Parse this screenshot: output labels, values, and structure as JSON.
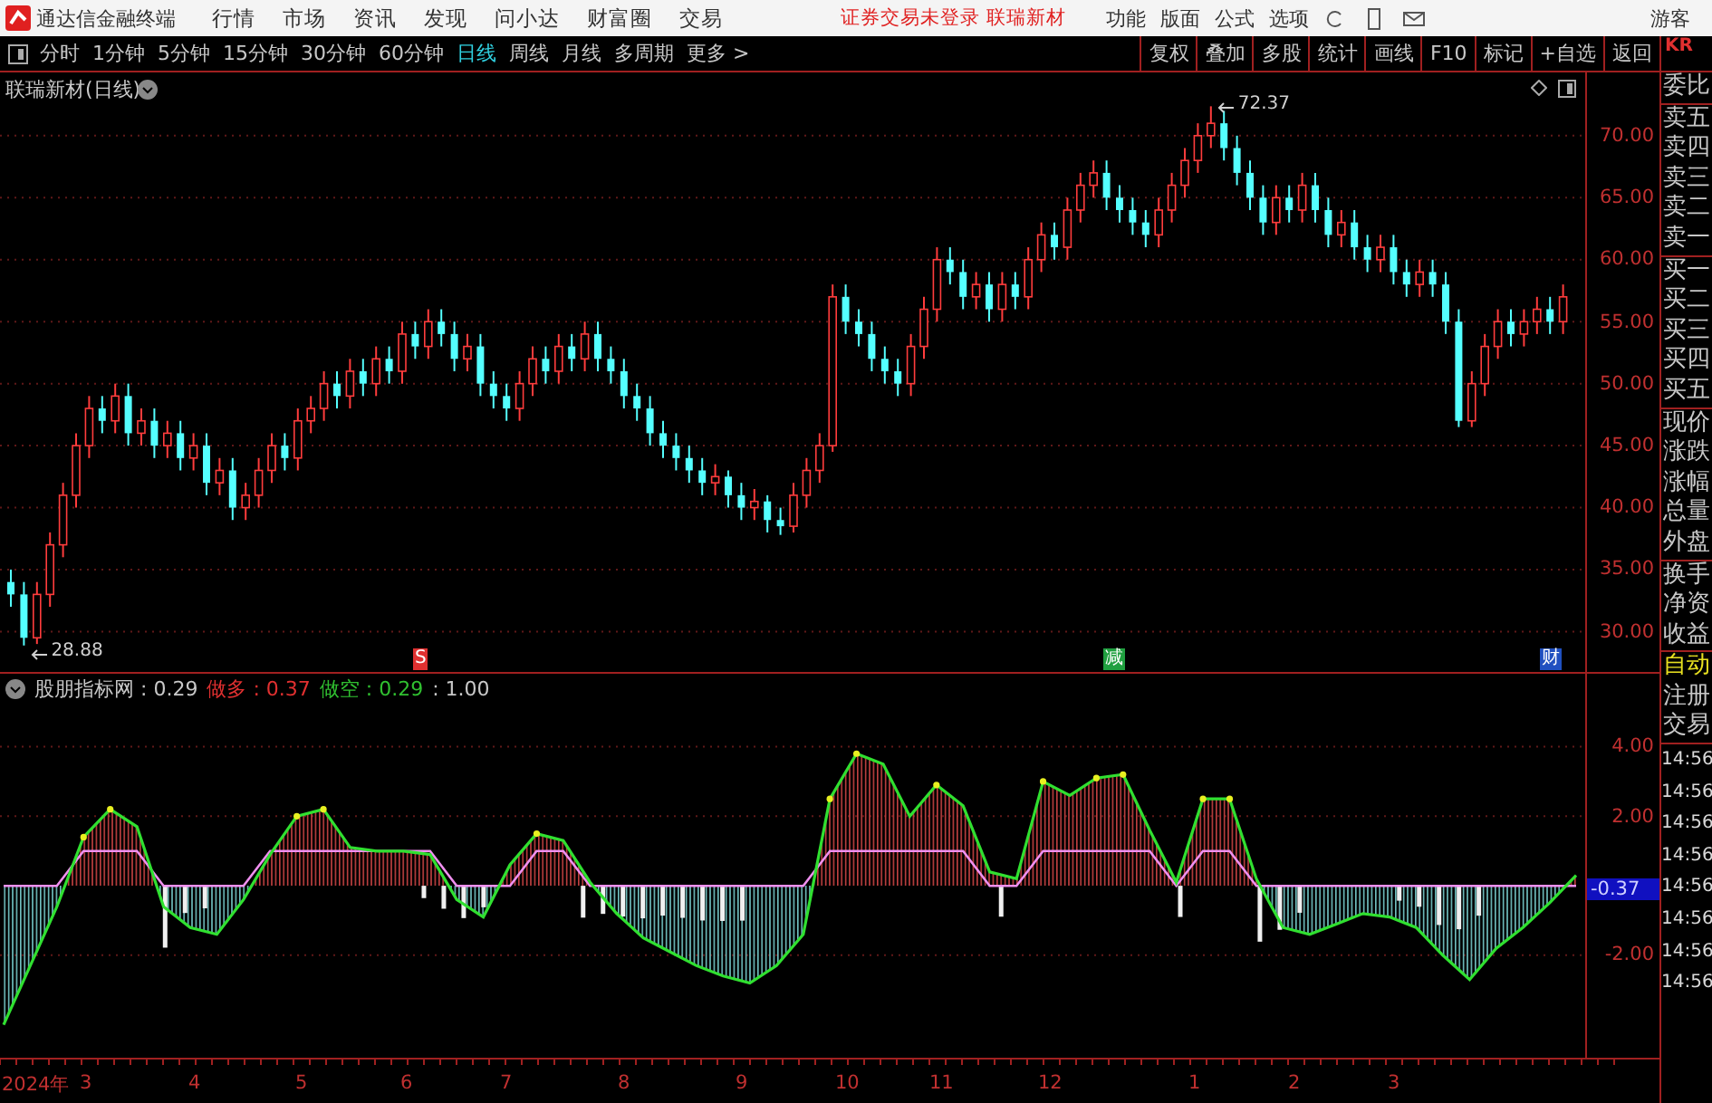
{
  "title_bar": {
    "app_name": "通达信金融终端",
    "menus": [
      "行情",
      "市场",
      "资讯",
      "发现",
      "问小达",
      "财富圈",
      "交易"
    ],
    "notice": "证券交易未登录  联瑞新材",
    "tools": [
      "功能",
      "版面",
      "公式",
      "选项"
    ],
    "user": "游客"
  },
  "toolbar": {
    "periods": [
      {
        "label": "分时",
        "selected": false
      },
      {
        "label": "1分钟",
        "selected": false
      },
      {
        "label": "5分钟",
        "selected": false
      },
      {
        "label": "15分钟",
        "selected": false
      },
      {
        "label": "30分钟",
        "selected": false
      },
      {
        "label": "60分钟",
        "selected": false
      },
      {
        "label": "日线",
        "selected": true
      },
      {
        "label": "周线",
        "selected": false
      },
      {
        "label": "月线",
        "selected": false
      },
      {
        "label": "多周期",
        "selected": false
      },
      {
        "label": "更多 >",
        "selected": false
      }
    ],
    "actions": [
      "复权",
      "叠加",
      "多股",
      "统计",
      "画线",
      "F10",
      "标记",
      "+自选",
      "返回"
    ]
  },
  "main_chart": {
    "title": "联瑞新材(日线)",
    "high_label": "72.37",
    "low_label": "28.88",
    "markers": [
      {
        "text": "S",
        "color": "#e03030"
      },
      {
        "text": "减",
        "color": "#20a040"
      },
      {
        "text": "财",
        "color": "#2050c0"
      }
    ],
    "chart_data": {
      "type": "candlestick",
      "grid": true,
      "ylim": [
        26.6,
        75.1
      ],
      "yticks": [
        {
          "value": 70,
          "label": "70.00"
        },
        {
          "value": 65,
          "label": "65.00"
        },
        {
          "value": 60,
          "label": "60.00"
        },
        {
          "value": 55,
          "label": "55.00"
        },
        {
          "value": 50,
          "label": "50.00"
        },
        {
          "value": 45,
          "label": "45.00"
        },
        {
          "value": 40,
          "label": "40.00"
        },
        {
          "value": 35,
          "label": "35.00"
        },
        {
          "value": 30,
          "label": "30.00"
        }
      ],
      "ohlc": [
        [
          34,
          35,
          32,
          33
        ],
        [
          33,
          34,
          28.88,
          29.5
        ],
        [
          29.5,
          34,
          29,
          33
        ],
        [
          33,
          38,
          32,
          37
        ],
        [
          37,
          42,
          36,
          41
        ],
        [
          41,
          46,
          40,
          45
        ],
        [
          45,
          49,
          44,
          48
        ],
        [
          48,
          49,
          46,
          47
        ],
        [
          47,
          50,
          46,
          49
        ],
        [
          49,
          50,
          45,
          46
        ],
        [
          46,
          48,
          45,
          47
        ],
        [
          47,
          48,
          44,
          45
        ],
        [
          45,
          47,
          44,
          46
        ],
        [
          46,
          47,
          43,
          44
        ],
        [
          44,
          46,
          43,
          45
        ],
        [
          45,
          46,
          41,
          42
        ],
        [
          42,
          44,
          41,
          43
        ],
        [
          43,
          44,
          39,
          40
        ],
        [
          40,
          42,
          39,
          41
        ],
        [
          41,
          44,
          40,
          43
        ],
        [
          43,
          46,
          42,
          45
        ],
        [
          45,
          46,
          43,
          44
        ],
        [
          44,
          48,
          43,
          47
        ],
        [
          47,
          49,
          46,
          48
        ],
        [
          48,
          51,
          47,
          50
        ],
        [
          50,
          51,
          48,
          49
        ],
        [
          49,
          52,
          48,
          51
        ],
        [
          51,
          52,
          49,
          50
        ],
        [
          50,
          53,
          49,
          52
        ],
        [
          52,
          53,
          50,
          51
        ],
        [
          51,
          55,
          50,
          54
        ],
        [
          54,
          55,
          52,
          53
        ],
        [
          53,
          56,
          52,
          55
        ],
        [
          55,
          56,
          53,
          54
        ],
        [
          54,
          55,
          51,
          52
        ],
        [
          52,
          54,
          51,
          53
        ],
        [
          53,
          54,
          49,
          50
        ],
        [
          50,
          51,
          48,
          49
        ],
        [
          49,
          50,
          47,
          48
        ],
        [
          48,
          51,
          47,
          50
        ],
        [
          50,
          53,
          49,
          52
        ],
        [
          52,
          53,
          50,
          51
        ],
        [
          51,
          54,
          50,
          53
        ],
        [
          53,
          54,
          51,
          52
        ],
        [
          52,
          55,
          51,
          54
        ],
        [
          54,
          55,
          51,
          52
        ],
        [
          52,
          53,
          50,
          51
        ],
        [
          51,
          52,
          48,
          49
        ],
        [
          49,
          50,
          47,
          48
        ],
        [
          48,
          49,
          45,
          46
        ],
        [
          46,
          47,
          44,
          45
        ],
        [
          45,
          46,
          43,
          44
        ],
        [
          44,
          45,
          42,
          43
        ],
        [
          43,
          44,
          41,
          42
        ],
        [
          42,
          43.5,
          41,
          42.5
        ],
        [
          42.5,
          43,
          40,
          41
        ],
        [
          41,
          42,
          39,
          40
        ],
        [
          40,
          41.5,
          39,
          40.5
        ],
        [
          40.5,
          41,
          38,
          39
        ],
        [
          39,
          40,
          37.8,
          38.5
        ],
        [
          38.5,
          42,
          38,
          41
        ],
        [
          41,
          44,
          40,
          43
        ],
        [
          43,
          46,
          42,
          45
        ],
        [
          45,
          58,
          44.5,
          57
        ],
        [
          57,
          58,
          54,
          55
        ],
        [
          55,
          56,
          53,
          54
        ],
        [
          54,
          55,
          51,
          52
        ],
        [
          52,
          53,
          50,
          51
        ],
        [
          51,
          52,
          49,
          50
        ],
        [
          50,
          54,
          49,
          53
        ],
        [
          53,
          57,
          52,
          56
        ],
        [
          56,
          61,
          55,
          60
        ],
        [
          60,
          61,
          58,
          59
        ],
        [
          59,
          60,
          56,
          57
        ],
        [
          57,
          59,
          56,
          58
        ],
        [
          58,
          59,
          55,
          56
        ],
        [
          56,
          59,
          55,
          58
        ],
        [
          58,
          59,
          56,
          57
        ],
        [
          57,
          61,
          56,
          60
        ],
        [
          60,
          63,
          59,
          62
        ],
        [
          62,
          63,
          60,
          61
        ],
        [
          61,
          65,
          60,
          64
        ],
        [
          64,
          67,
          63,
          66
        ],
        [
          66,
          68,
          65,
          67
        ],
        [
          67,
          68,
          64,
          65
        ],
        [
          65,
          66,
          63,
          64
        ],
        [
          64,
          65,
          62,
          63
        ],
        [
          63,
          64,
          61,
          62
        ],
        [
          62,
          65,
          61,
          64
        ],
        [
          64,
          67,
          63,
          66
        ],
        [
          66,
          69,
          65,
          68
        ],
        [
          68,
          71,
          67,
          70
        ],
        [
          70,
          72.37,
          69,
          71
        ],
        [
          71,
          72,
          68,
          69
        ],
        [
          69,
          70,
          66,
          67
        ],
        [
          67,
          68,
          64,
          65
        ],
        [
          65,
          66,
          62,
          63
        ],
        [
          63,
          66,
          62,
          65
        ],
        [
          65,
          66,
          63,
          64
        ],
        [
          64,
          67,
          63,
          66
        ],
        [
          66,
          67,
          63,
          64
        ],
        [
          64,
          65,
          61,
          62
        ],
        [
          62,
          64,
          61,
          63
        ],
        [
          63,
          64,
          60,
          61
        ],
        [
          61,
          62,
          59,
          60
        ],
        [
          60,
          62,
          59,
          61
        ],
        [
          61,
          62,
          58,
          59
        ],
        [
          59,
          60,
          57,
          58
        ],
        [
          58,
          60,
          57,
          59
        ],
        [
          59,
          60,
          57,
          58
        ],
        [
          58,
          59,
          54,
          55
        ],
        [
          55,
          56,
          46.5,
          47
        ],
        [
          47,
          51,
          46.5,
          50
        ],
        [
          50,
          54,
          49,
          53
        ],
        [
          53,
          56,
          52,
          55
        ],
        [
          55,
          56,
          53,
          54
        ],
        [
          54,
          56,
          53,
          55
        ],
        [
          55,
          57,
          54,
          56
        ],
        [
          56,
          57,
          54,
          55
        ],
        [
          55,
          58,
          54,
          57
        ]
      ]
    }
  },
  "indicator": {
    "legend": [
      {
        "text": "股朋指标网 : 0.29",
        "color": "#c8c8c8"
      },
      {
        "text": "做多 : 0.37",
        "color": "#e03030"
      },
      {
        "text": "做空 : 0.29",
        "color": "#30c030"
      },
      {
        "text": ": 1.00",
        "color": "#c8c8c8"
      }
    ],
    "current_value": "-0.37",
    "chart_data": {
      "type": "area",
      "grid": true,
      "ylim": [
        -5,
        6.1
      ],
      "yticks": [
        {
          "value": 4,
          "label": "4.00"
        },
        {
          "value": 2,
          "label": "2.00"
        },
        {
          "value": -2,
          "label": "-2.00"
        }
      ],
      "series": [
        {
          "color": "#30e030",
          "values": [
            -4,
            -2.3,
            -0.6,
            1.4,
            2.2,
            1.7,
            -0.6,
            -1.2,
            -1.4,
            -0.4,
            0.9,
            2.0,
            2.2,
            1.1,
            1.0,
            1.0,
            0.9,
            -0.4,
            -0.9,
            0.6,
            1.5,
            1.3,
            0.1,
            -0.8,
            -1.5,
            -1.9,
            -2.3,
            -2.6,
            -2.8,
            -2.3,
            -1.4,
            2.5,
            3.8,
            3.5,
            2.0,
            2.9,
            2.3,
            0.4,
            0.2,
            3.0,
            2.6,
            3.1,
            3.2,
            1.6,
            0.1,
            2.5,
            2.5,
            0.2,
            -1.2,
            -1.4,
            -1.1,
            -0.8,
            -0.9,
            -1.2,
            -2.0,
            -2.7,
            -1.8,
            -1.2,
            -0.5,
            0.3
          ]
        },
        {
          "type": "line",
          "color": "#f090f0",
          "values": [
            0,
            0,
            0,
            1,
            1,
            1,
            0,
            0,
            0,
            0,
            1,
            1,
            1,
            1,
            1,
            1,
            1,
            0,
            0,
            0,
            1,
            1,
            0,
            0,
            0,
            0,
            0,
            0,
            0,
            0,
            0,
            1,
            1,
            1,
            1,
            1,
            1,
            0,
            0,
            1,
            1,
            1,
            1,
            1,
            0,
            1,
            1,
            0,
            0,
            0,
            0,
            0,
            0,
            0,
            0,
            0,
            0,
            0,
            0,
            0
          ]
        }
      ]
    }
  },
  "time_axis": [
    "2024年",
    "3",
    "4",
    "5",
    "6",
    "7",
    "8",
    "9",
    "10",
    "11",
    "12",
    "1",
    "2",
    "3"
  ],
  "side_panel": {
    "header": "KR",
    "groups": [
      [
        "委比"
      ],
      [
        "卖五",
        "卖四",
        "卖三",
        "卖二",
        "卖一"
      ],
      [
        "买一",
        "买二",
        "买三",
        "买四",
        "买五"
      ],
      [
        "现价",
        "涨跌",
        "涨幅",
        "总量",
        "外盘"
      ],
      [
        "换手",
        "净资",
        "收益"
      ]
    ],
    "mode_buttons": [
      {
        "label": "自动",
        "on": true
      },
      {
        "label": "注册",
        "on": false
      },
      {
        "label": "交易",
        "on": false
      }
    ],
    "times": [
      "14:56",
      "14:56",
      "14:56",
      "14:56",
      "14:56",
      "14:56",
      "14:56",
      "14:56"
    ]
  }
}
